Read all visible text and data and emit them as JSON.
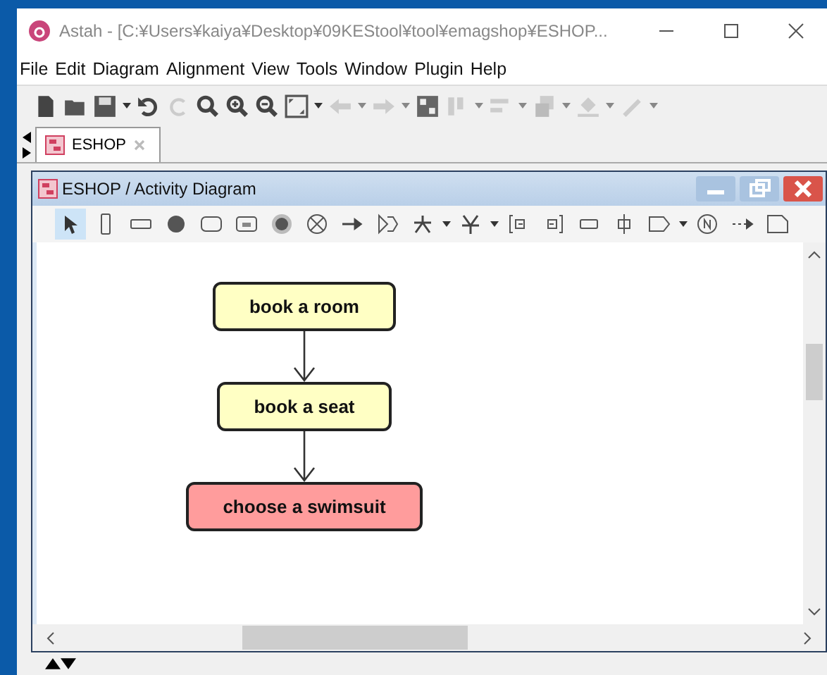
{
  "window": {
    "title": "Astah - [C:¥Users¥kaiya¥Desktop¥09KEStool¥tool¥emagshop¥ESHOP..."
  },
  "menu": [
    "File",
    "Edit",
    "Diagram",
    "Alignment",
    "View",
    "Tools",
    "Window",
    "Plugin",
    "Help"
  ],
  "tabs": [
    {
      "label": "ESHOP",
      "selected": true
    }
  ],
  "diagram_frame": {
    "title": "ESHOP / Activity Diagram"
  },
  "palette": [
    {
      "kind": "pointer",
      "selected": true
    },
    {
      "kind": "partition",
      "selected": false
    },
    {
      "kind": "hpartition",
      "selected": false
    },
    {
      "kind": "initial",
      "selected": false
    },
    {
      "kind": "action",
      "selected": false
    },
    {
      "kind": "object",
      "selected": false
    },
    {
      "kind": "final",
      "selected": false
    },
    {
      "kind": "flowfinal",
      "selected": false
    },
    {
      "kind": "flow",
      "selected": false
    },
    {
      "kind": "signal",
      "selected": false
    },
    {
      "kind": "fork",
      "selected": false
    },
    {
      "kind": "join",
      "selected": false
    },
    {
      "kind": "pinin",
      "selected": false
    },
    {
      "kind": "pinout",
      "selected": false
    },
    {
      "kind": "rect",
      "selected": false
    },
    {
      "kind": "port",
      "selected": false
    },
    {
      "kind": "send",
      "selected": false
    },
    {
      "kind": "note",
      "selected": false
    },
    {
      "kind": "dashed",
      "selected": false
    },
    {
      "kind": "comment",
      "selected": false
    }
  ],
  "nodes": [
    {
      "label": "book a room",
      "color": "#ffffc4"
    },
    {
      "label": "book a seat",
      "color": "#ffffc4"
    },
    {
      "label": "choose a swimsuit",
      "color": "#ff9c9c"
    }
  ]
}
